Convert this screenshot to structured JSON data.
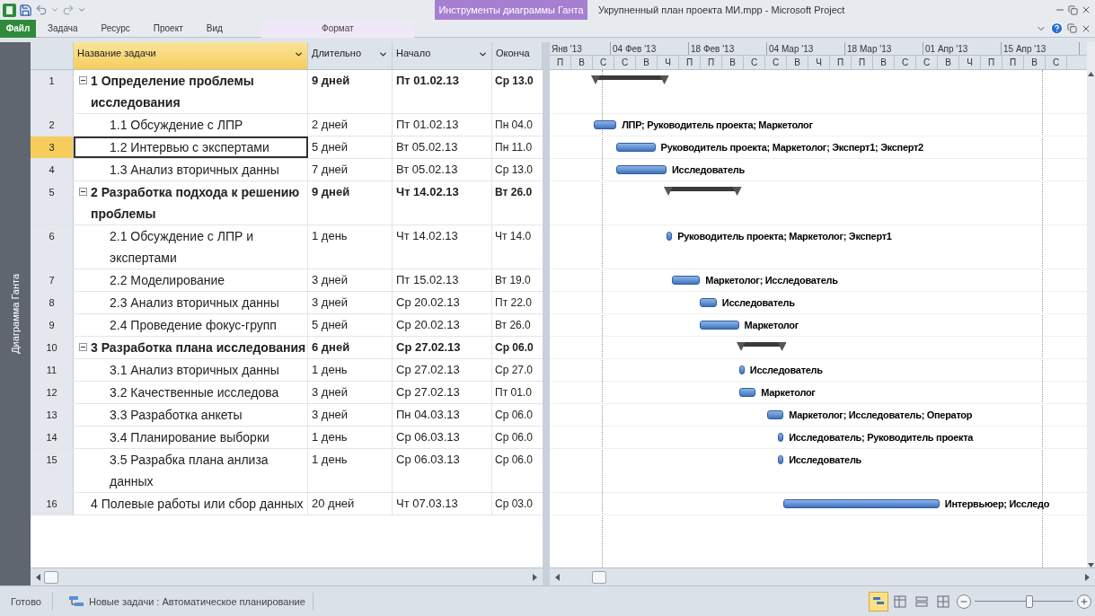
{
  "title_bar": {
    "contextual_tab": "Инструменты диаграммы Ганта",
    "title": "Укрупненный план проекта МИ.mpp - Microsoft Project"
  },
  "ribbon_tabs": [
    {
      "label": "Файл",
      "kind": "file"
    },
    {
      "label": "Задача",
      "kind": "tab"
    },
    {
      "label": "Ресурс",
      "kind": "tab"
    },
    {
      "label": "Проект",
      "kind": "tab"
    },
    {
      "label": "Вид",
      "kind": "tab"
    },
    {
      "label": "Формат",
      "kind": "contextual"
    }
  ],
  "view_bar": {
    "label": "Диаграмма Ганта"
  },
  "columns": [
    {
      "label": "Название задачи",
      "selected": true,
      "filter": true
    },
    {
      "label": "Длительно",
      "selected": false,
      "filter": true
    },
    {
      "label": "Начало",
      "selected": false,
      "filter": true
    },
    {
      "label": "Оконча",
      "selected": false,
      "filter": false
    }
  ],
  "timescale": {
    "major": [
      "Янв '13",
      "04 Фев '13",
      "18 Фев '13",
      "04 Мар '13",
      "18 Мар '13",
      "01 Апр '13",
      "15 Апр '13"
    ],
    "minor": [
      "П",
      "В",
      "С",
      "С",
      "В",
      "Ч",
      "П",
      "П",
      "В",
      "С",
      "С",
      "В",
      "Ч",
      "П",
      "П",
      "В",
      "С",
      "С",
      "В",
      "Ч",
      "П",
      "П",
      "В",
      "С"
    ]
  },
  "tasks": [
    {
      "number": "1",
      "name": "1 Определение проблемы исследования",
      "duration": "9 дней",
      "start": "Пт 01.02.13",
      "finish": "Ср 13.0",
      "selected": false,
      "expanded": true,
      "children": [
        {
          "number": "2",
          "name": "1.1 Обсуждение с ЛПР",
          "duration": "2 дней",
          "start": "Пт 01.02.13",
          "finish": "Пн 04.0",
          "selected": false,
          "resources": "ЛПР; Руководитель проекта; Маркетолог"
        },
        {
          "number": "3",
          "name": "1.2 Интервью с экспертами",
          "duration": "5 дней",
          "start": "Вт 05.02.13",
          "finish": "Пн 11.0",
          "selected": true,
          "resources": "Руководитель проекта; Маркетолог; Эксперт1; Эксперт2"
        },
        {
          "number": "4",
          "name": "1.3 Анализ вторичных данны",
          "duration": "7 дней",
          "start": "Вт 05.02.13",
          "finish": "Ср 13.0",
          "selected": false,
          "resources": "Исследователь"
        }
      ]
    },
    {
      "number": "5",
      "name": "2 Разработка подхода к решению проблемы",
      "duration": "9 дней",
      "start": "Чт 14.02.13",
      "finish": "Вт 26.0",
      "selected": false,
      "expanded": true,
      "children": [
        {
          "number": "6",
          "name": "2.1 Обсуждение с ЛПР и экспертами",
          "duration": "1 день",
          "start": "Чт 14.02.13",
          "finish": "Чт 14.0",
          "selected": false,
          "resources": "Руководитель проекта; Маркетолог; Эксперт1"
        },
        {
          "number": "7",
          "name": "2.2 Моделирование",
          "duration": "3 дней",
          "start": "Пт 15.02.13",
          "finish": "Вт 19.0",
          "selected": false,
          "resources": "Маркетолог; Исследователь"
        },
        {
          "number": "8",
          "name": "2.3 Анализ вторичных данны",
          "duration": "3 дней",
          "start": "Ср 20.02.13",
          "finish": "Пт 22.0",
          "selected": false,
          "resources": "Исследователь"
        },
        {
          "number": "9",
          "name": "2.4 Проведение фокус-групп",
          "duration": "5 дней",
          "start": "Ср 20.02.13",
          "finish": "Вт 26.0",
          "selected": false,
          "resources": "Маркетолог"
        }
      ]
    },
    {
      "number": "10",
      "name": "3 Разработка плана исследования",
      "duration": "6 дней",
      "start": "Ср 27.02.13",
      "finish": "Ср 06.0",
      "selected": false,
      "expanded": true,
      "children": [
        {
          "number": "11",
          "name": "3.1 Анализ вторичных данны",
          "duration": "1 день",
          "start": "Ср 27.02.13",
          "finish": "Ср 27.0",
          "selected": false,
          "resources": "Исследователь"
        },
        {
          "number": "12",
          "name": "3.2 Качественные исследова",
          "duration": "3 дней",
          "start": "Ср 27.02.13",
          "finish": "Пт 01.0",
          "selected": false,
          "resources": "Маркетолог"
        },
        {
          "number": "13",
          "name": "3.3 Разработка анкеты",
          "duration": "3 дней",
          "start": "Пн 04.03.13",
          "finish": "Ср 06.0",
          "selected": false,
          "resources": "Маркетолог; Исследователь; Оператор"
        },
        {
          "number": "14",
          "name": "3.4 Планирование выборки",
          "duration": "1 день",
          "start": "Ср 06.03.13",
          "finish": "Ср 06.0",
          "selected": false,
          "resources": "Исследователь; Руководитель проекта"
        },
        {
          "number": "15",
          "name": "3.5 Разрабка плана анлиза данных",
          "duration": "1 день",
          "start": "Ср 06.03.13",
          "finish": "Ср 06.0",
          "selected": false,
          "resources": "Исследователь"
        }
      ]
    },
    {
      "number": "16",
      "name": "4 Полевые работы или сбор данных",
      "duration": "20 дней",
      "start": "Чт 07.03.13",
      "finish": "Ср 03.0",
      "selected": false,
      "resources": "Интервьюер; Исследо"
    }
  ],
  "status_bar": {
    "ready": "Готово",
    "mode": "Новые задачи : Автоматическое планирование",
    "views": [
      {
        "kind": "gantt",
        "selected": true
      },
      {
        "kind": "usage",
        "selected": false
      },
      {
        "kind": "team",
        "selected": false
      },
      {
        "kind": "sheet",
        "selected": false
      }
    ],
    "zoom": {
      "level": 0.55
    }
  }
}
